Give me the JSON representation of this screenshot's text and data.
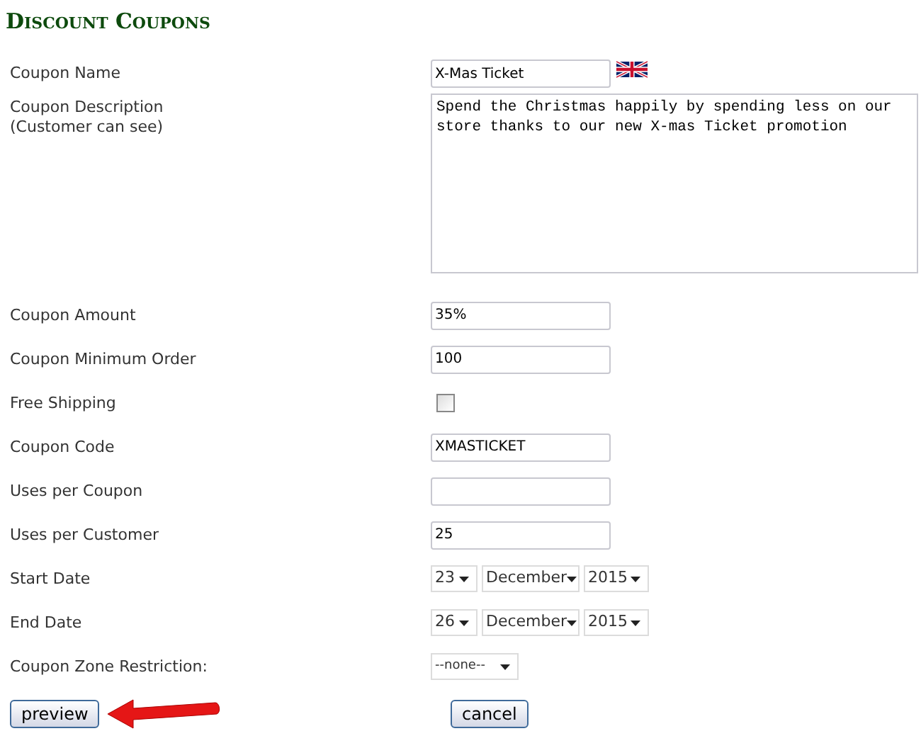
{
  "title": "Discount Coupons",
  "fields": [
    {
      "kind": "text",
      "label": "Coupon Name",
      "value": "X-Mas Ticket",
      "flag": true
    },
    {
      "kind": "textarea",
      "label": "Coupon Description",
      "sublabel": "(Customer can see)",
      "value": "Spend the Christmas happily by spending less on our store thanks to our new X-mas Ticket promotion"
    },
    {
      "kind": "text",
      "label": "Coupon Amount",
      "value": "35%"
    },
    {
      "kind": "text",
      "label": "Coupon Minimum Order",
      "value": "100"
    },
    {
      "kind": "checkbox",
      "label": "Free Shipping",
      "checked": false
    },
    {
      "kind": "text",
      "label": "Coupon Code",
      "value": "XMASTICKET"
    },
    {
      "kind": "text",
      "label": "Uses per Coupon"
    },
    {
      "kind": "text",
      "label": "Uses per Customer",
      "value": "25"
    },
    {
      "kind": "date",
      "label": "Start Date",
      "day": "23",
      "month": "December",
      "year": "2015"
    },
    {
      "kind": "date",
      "label": "End Date",
      "day": "26",
      "month": "December",
      "year": "2015"
    },
    {
      "kind": "select",
      "label": "Coupon Zone Restriction:",
      "value": "--none--"
    }
  ],
  "buttons": [
    {
      "label": "preview",
      "highlighted": true
    },
    {
      "label": "cancel",
      "highlighted": false
    }
  ]
}
